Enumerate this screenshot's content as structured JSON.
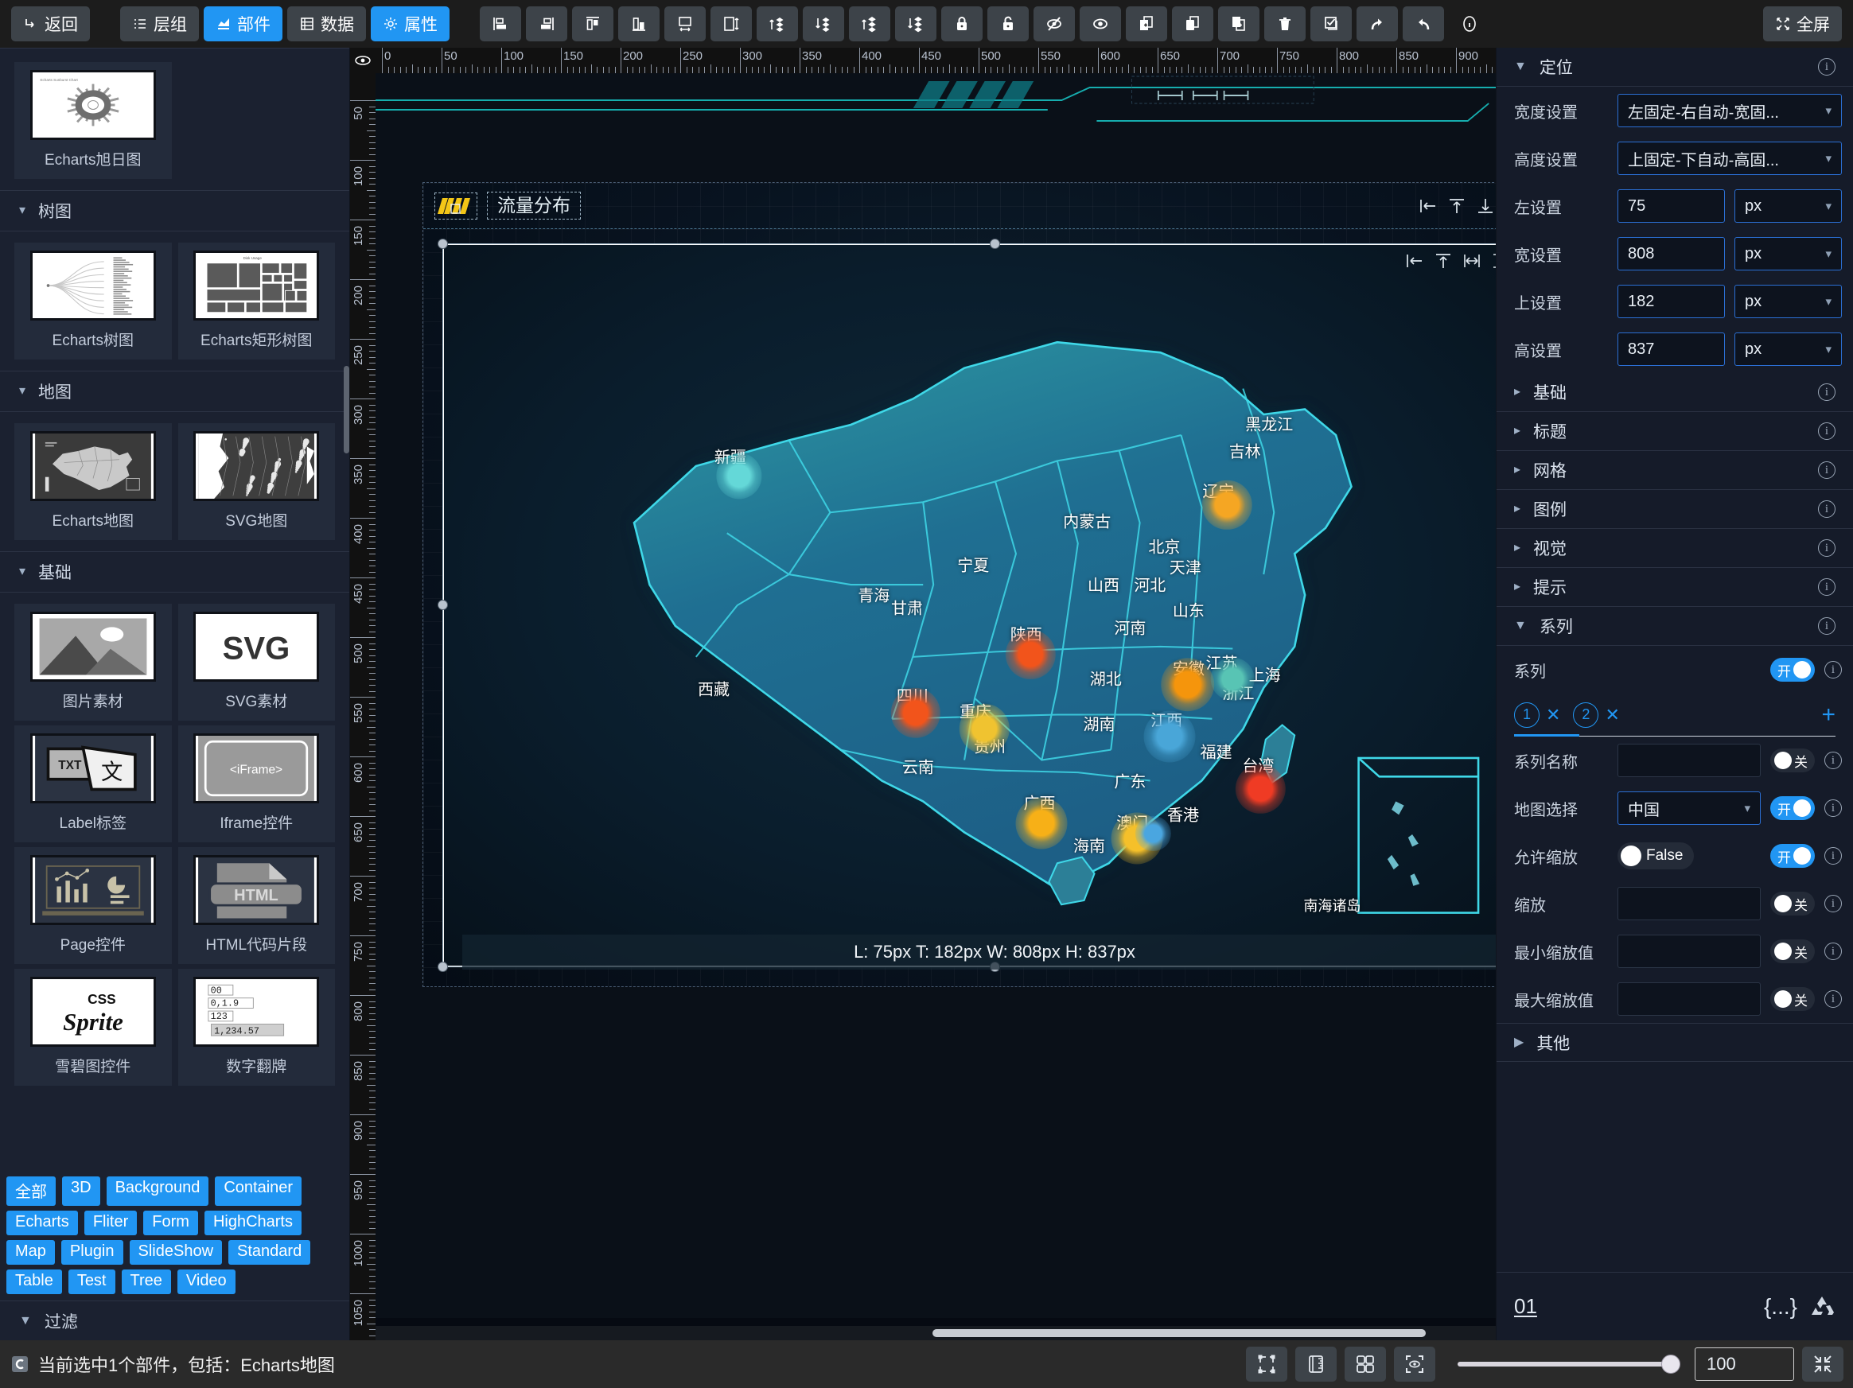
{
  "toolbar": {
    "back_label": "返回",
    "layers_label": "层组",
    "widgets_label": "部件",
    "data_label": "数据",
    "props_label": "属性",
    "fullscreen_label": "全屏",
    "icons": [
      "align-left-icon",
      "align-right-icon",
      "align-top-icon",
      "align-bottom-icon",
      "distribute-horizontal-icon",
      "distribute-vertical-icon",
      "bring-forward-icon",
      "send-backward-icon",
      "bring-to-front-icon",
      "send-to-back-icon",
      "lock-icon",
      "unlock-icon",
      "hide-icon",
      "show-icon",
      "add-page-icon",
      "copy-icon",
      "duplicate-icon",
      "delete-icon",
      "select-all-icon",
      "redo-icon",
      "undo-icon",
      "info-icon"
    ]
  },
  "left_panel": {
    "categories": [
      {
        "name": "",
        "items": [
          {
            "label": "Echarts旭日图",
            "thumb": "sunburst-thumb"
          }
        ]
      },
      {
        "name": "树图",
        "items": [
          {
            "label": "Echarts树图",
            "thumb": "tree-thumb"
          },
          {
            "label": "Echarts矩形树图",
            "thumb": "treemap-thumb"
          }
        ]
      },
      {
        "name": "地图",
        "items": [
          {
            "label": "Echarts地图",
            "thumb": "china-map-thumb"
          },
          {
            "label": "SVG地图",
            "thumb": "svg-map-thumb"
          }
        ]
      },
      {
        "name": "基础",
        "items": [
          {
            "label": "图片素材",
            "thumb": "image-thumb"
          },
          {
            "label": "SVG素材",
            "thumb": "svg-thumb"
          },
          {
            "label": "Label标签",
            "thumb": "txt-thumb"
          },
          {
            "label": "Iframe控件",
            "thumb": "iframe-thumb"
          },
          {
            "label": "Page控件",
            "thumb": "page-thumb"
          },
          {
            "label": "HTML代码片段",
            "thumb": "html-thumb"
          },
          {
            "label": "雪碧图控件",
            "thumb": "csssprite-thumb"
          },
          {
            "label": "数字翻牌",
            "thumb": "flipnumber-thumb"
          }
        ]
      }
    ],
    "tags": [
      "全部",
      "3D",
      "Background",
      "Container",
      "Echarts",
      "Fliter",
      "Form",
      "HighCharts",
      "Map",
      "Plugin",
      "SlideShow",
      "Standard",
      "Table",
      "Test",
      "Tree",
      "Video"
    ],
    "filter_label": "过滤"
  },
  "canvas": {
    "ruler_h_labels": [
      "0",
      "50",
      "100",
      "150",
      "200",
      "250",
      "300",
      "350",
      "400",
      "450",
      "500",
      "550",
      "600",
      "650",
      "700",
      "750",
      "800",
      "850",
      "900"
    ],
    "ruler_v_labels": [
      "50",
      "100",
      "150",
      "200",
      "250",
      "300",
      "350",
      "400",
      "450",
      "500",
      "550",
      "600",
      "650",
      "700",
      "750",
      "800",
      "850",
      "900",
      "950",
      "1000",
      "1050"
    ],
    "widget_title": "流量分布",
    "hud": "L: 75px T: 182px W: 808px H: 837px",
    "header_tool_icons": [
      "align-left-icon",
      "align-top-icon",
      "align-bottom-icon",
      "fit-width-icon",
      "lock-icon"
    ],
    "map_tool_icons": [
      "align-left-icon",
      "align-top-icon",
      "fit-width-icon",
      "fit-height-icon",
      "unlock-icon"
    ],
    "south_sea_label": "南海诸岛"
  },
  "chart_data": {
    "type": "scatter",
    "title": "流量分布",
    "map": "中国",
    "region_labels": [
      {
        "name": "新疆",
        "x": 26.0,
        "y": 29.3
      },
      {
        "name": "黑龙江",
        "x": 74.8,
        "y": 24.8
      },
      {
        "name": "吉林",
        "x": 72.6,
        "y": 28.5
      },
      {
        "name": "辽宁",
        "x": 70.2,
        "y": 34.0
      },
      {
        "name": "内蒙古",
        "x": 58.3,
        "y": 38.2
      },
      {
        "name": "北京",
        "x": 65.3,
        "y": 41.7
      },
      {
        "name": "天津",
        "x": 67.2,
        "y": 44.6
      },
      {
        "name": "宁夏",
        "x": 48.0,
        "y": 44.3
      },
      {
        "name": "山西",
        "x": 59.8,
        "y": 47.0
      },
      {
        "name": "河北",
        "x": 64.0,
        "y": 47.0
      },
      {
        "name": "青海",
        "x": 39.0,
        "y": 48.5
      },
      {
        "name": "甘肃",
        "x": 42.0,
        "y": 50.2
      },
      {
        "name": "山东",
        "x": 67.5,
        "y": 50.6
      },
      {
        "name": "陕西",
        "x": 52.8,
        "y": 53.8
      },
      {
        "name": "河南",
        "x": 62.2,
        "y": 53.0
      },
      {
        "name": "四川",
        "x": 42.5,
        "y": 62.3
      },
      {
        "name": "重庆",
        "x": 48.2,
        "y": 64.5
      },
      {
        "name": "西藏",
        "x": 24.5,
        "y": 61.5
      },
      {
        "name": "湖北",
        "x": 60.0,
        "y": 60.0
      },
      {
        "name": "安徽",
        "x": 67.5,
        "y": 58.6
      },
      {
        "name": "江苏",
        "x": 70.5,
        "y": 57.8
      },
      {
        "name": "上海",
        "x": 74.4,
        "y": 59.5
      },
      {
        "name": "浙江",
        "x": 72.0,
        "y": 62.0
      },
      {
        "name": "江西",
        "x": 65.5,
        "y": 65.8
      },
      {
        "name": "湖南",
        "x": 59.4,
        "y": 66.3
      },
      {
        "name": "贵州",
        "x": 49.5,
        "y": 69.4
      },
      {
        "name": "福建",
        "x": 70.0,
        "y": 70.2
      },
      {
        "name": "云南",
        "x": 43.0,
        "y": 72.2
      },
      {
        "name": "广东",
        "x": 62.2,
        "y": 74.2
      },
      {
        "name": "台湾",
        "x": 73.8,
        "y": 72.0
      },
      {
        "name": "广西",
        "x": 54.0,
        "y": 77.2
      },
      {
        "name": "香港",
        "x": 67.0,
        "y": 78.8
      },
      {
        "name": "澳门",
        "x": 62.4,
        "y": 80.0
      },
      {
        "name": "海南",
        "x": 58.5,
        "y": 83.2
      }
    ],
    "points": [
      {
        "name": "新疆",
        "x": 26.8,
        "y": 32.1,
        "color": "#64d8d8",
        "size": 22
      },
      {
        "name": "辽宁",
        "x": 71.0,
        "y": 36.1,
        "color": "#f5a623",
        "size": 24
      },
      {
        "name": "陕西",
        "x": 53.2,
        "y": 56.8,
        "color": "#f2541b",
        "size": 24
      },
      {
        "name": "四川",
        "x": 42.8,
        "y": 64.9,
        "color": "#f2541b",
        "size": 24
      },
      {
        "name": "重庆",
        "x": 49.0,
        "y": 67.1,
        "color": "#f0c330",
        "size": 24
      },
      {
        "name": "安徽",
        "x": 67.4,
        "y": 61.0,
        "color": "#f5950c",
        "size": 26
      },
      {
        "name": "上海",
        "x": 71.5,
        "y": 60.2,
        "color": "#58c4b4",
        "size": 21
      },
      {
        "name": "江西",
        "x": 65.8,
        "y": 68.2,
        "color": "#49a6d8",
        "size": 25
      },
      {
        "name": "台湾",
        "x": 74.0,
        "y": 75.4,
        "color": "#ef3b24",
        "size": 24
      },
      {
        "name": "广西",
        "x": 54.2,
        "y": 80.2,
        "color": "#f7b017",
        "size": 25
      },
      {
        "name": "澳门",
        "x": 62.8,
        "y": 82.3,
        "color": "#f5c02a",
        "size": 25
      },
      {
        "name": "香港",
        "x": 64.3,
        "y": 81.6,
        "color": "#4aa6e0",
        "size": 17
      }
    ],
    "legend": [],
    "grid": true
  },
  "right_panel": {
    "position_section": {
      "title": "定位",
      "rows": [
        {
          "label": "宽度设置",
          "type": "select",
          "value": "左固定-右自动-宽固..."
        },
        {
          "label": "高度设置",
          "type": "select",
          "value": "上固定-下自动-高固..."
        },
        {
          "label": "左设置",
          "type": "input-unit",
          "value": "75",
          "unit": "px"
        },
        {
          "label": "宽设置",
          "type": "input-unit",
          "value": "808",
          "unit": "px"
        },
        {
          "label": "上设置",
          "type": "input-unit",
          "value": "182",
          "unit": "px"
        },
        {
          "label": "高设置",
          "type": "input-unit",
          "value": "837",
          "unit": "px"
        }
      ]
    },
    "collapsed_sections": [
      "基础",
      "标题",
      "网格",
      "图例",
      "视觉",
      "提示"
    ],
    "series_section": {
      "title": "系列",
      "enable_label": "系列",
      "enable_state": "开",
      "tabs": [
        "1",
        "2"
      ],
      "add_label": "+",
      "rows": [
        {
          "label": "系列名称",
          "type": "input",
          "value": "",
          "toggle": "关",
          "on": false
        },
        {
          "label": "地图选择",
          "type": "select",
          "value": "中国",
          "toggle": "开",
          "on": true
        },
        {
          "label": "允许缩放",
          "type": "bool",
          "value": "False",
          "toggle": "开",
          "on": true
        },
        {
          "label": "缩放",
          "type": "input",
          "value": "",
          "toggle": "关",
          "on": false
        },
        {
          "label": "最小缩放值",
          "type": "input",
          "value": "",
          "toggle": "关",
          "on": false
        },
        {
          "label": "最大缩放值",
          "type": "input",
          "value": "",
          "toggle": "关",
          "on": false
        }
      ]
    },
    "other_section": "其他",
    "footer": {
      "page_number": "01",
      "json_icon": "{...}",
      "recycle_icon": "recycle-icon"
    }
  },
  "statusbar": {
    "text": "当前选中1个部件，包括：Echarts地图",
    "icons": [
      "selection-frame-icon",
      "ruler-icon",
      "grid-icon",
      "preview-icon"
    ],
    "zoom_value": "100",
    "zoom_percent": 100,
    "collapse_icon": "collapse-icon"
  }
}
